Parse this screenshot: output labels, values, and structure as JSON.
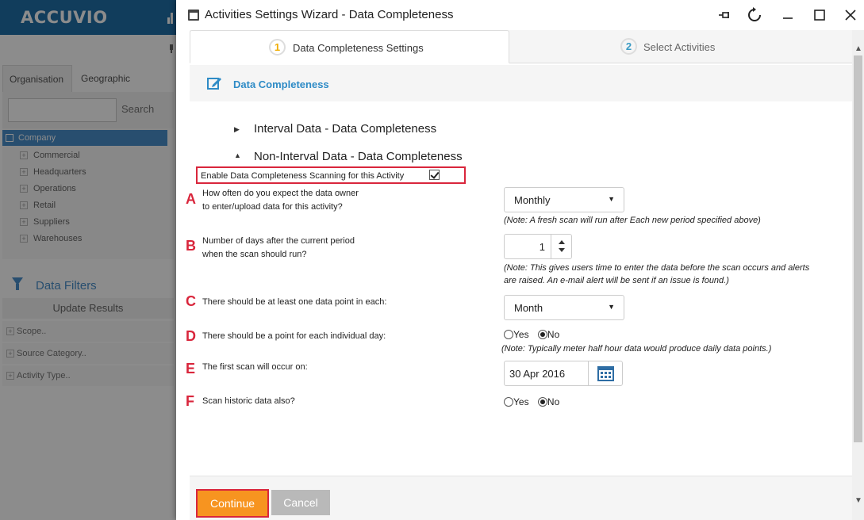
{
  "background_app": {
    "logo": "ACCUVIO",
    "tabs": [
      "Organisation",
      "Geographic"
    ],
    "search_button": "Search",
    "tree_root": "Company",
    "tree_items": [
      "Commercial",
      "Headquarters",
      "Operations",
      "Retail",
      "Suppliers",
      "Warehouses"
    ],
    "filters_title": "Data Filters",
    "update_button": "Update Results",
    "facets": [
      "Scope..",
      "Source Category..",
      "Activity Type.."
    ]
  },
  "dialog": {
    "title": "Activities Settings Wizard - Data Completeness",
    "steps": [
      {
        "num": "1",
        "label": "Data Completeness Settings"
      },
      {
        "num": "2",
        "label": "Select Activities"
      }
    ],
    "section_title": "Data Completeness",
    "accordion": [
      {
        "label": "Interval Data - Data Completeness",
        "state": "collapsed"
      },
      {
        "label": "Non-Interval Data - Data Completeness",
        "state": "expanded"
      }
    ],
    "enable_label": "Enable Data Completeness Scanning for this Activity",
    "enable_checked": true,
    "questions": {
      "a": {
        "letter": "A",
        "text_line1": "How often do you expect the data owner",
        "text_line2": "to enter/upload data for this activity?",
        "value": "Monthly",
        "note": "(Note: A fresh scan will run after Each new period specified above)"
      },
      "b": {
        "letter": "B",
        "text_line1": "Number of days after the current period",
        "text_line2": "when the scan should run?",
        "value": "1",
        "note_line1": "(Note: This gives users time to enter the data before the scan occurs and alerts",
        "note_line2": "are raised. An e-mail alert will be sent if an issue is found.)"
      },
      "c": {
        "letter": "C",
        "text": "There should be at least one data point in each:",
        "value": "Month"
      },
      "d": {
        "letter": "D",
        "text": "There should be a point for each individual day:",
        "yes": "Yes",
        "no": "No",
        "selected": "No",
        "note": "(Note: Typically meter half hour data would produce daily data points.)"
      },
      "e": {
        "letter": "E",
        "text": "The first scan will occur on:",
        "value": "30 Apr 2016"
      },
      "f": {
        "letter": "F",
        "text": "Scan historic data also?",
        "yes": "Yes",
        "no": "No",
        "selected": "No"
      }
    },
    "buttons": {
      "continue": "Continue",
      "cancel": "Cancel"
    }
  },
  "colors": {
    "accent_blue": "#2e8bc6",
    "annotation_red": "#d9263c",
    "continue_orange": "#f79420",
    "cancel_grey": "#b9b9b9"
  }
}
